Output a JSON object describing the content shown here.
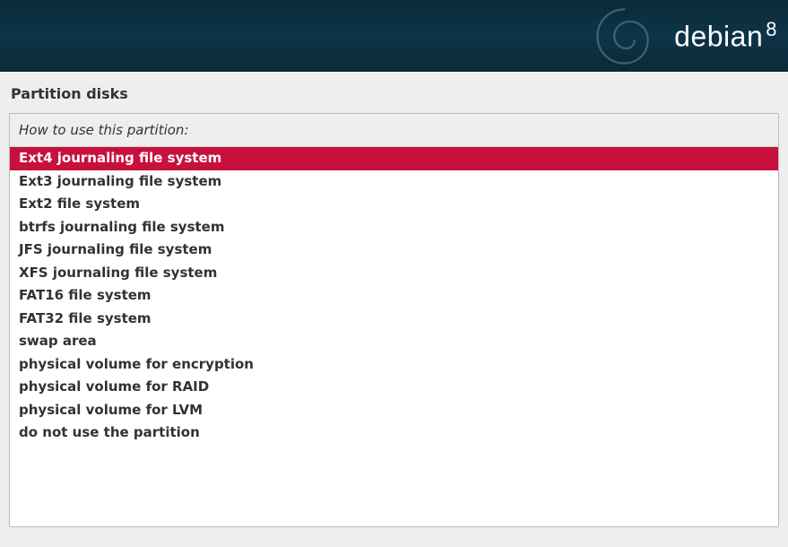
{
  "header": {
    "brand_name": "debian",
    "brand_version": "8"
  },
  "page": {
    "title": "Partition disks",
    "question": "How to use this partition:"
  },
  "options": [
    {
      "label": "Ext4 journaling file system",
      "selected": true
    },
    {
      "label": "Ext3 journaling file system",
      "selected": false
    },
    {
      "label": "Ext2 file system",
      "selected": false
    },
    {
      "label": "btrfs journaling file system",
      "selected": false
    },
    {
      "label": "JFS journaling file system",
      "selected": false
    },
    {
      "label": "XFS journaling file system",
      "selected": false
    },
    {
      "label": "FAT16 file system",
      "selected": false
    },
    {
      "label": "FAT32 file system",
      "selected": false
    },
    {
      "label": "swap area",
      "selected": false
    },
    {
      "label": "physical volume for encryption",
      "selected": false
    },
    {
      "label": "physical volume for RAID",
      "selected": false
    },
    {
      "label": "physical volume for LVM",
      "selected": false
    },
    {
      "label": "do not use the partition",
      "selected": false
    }
  ]
}
